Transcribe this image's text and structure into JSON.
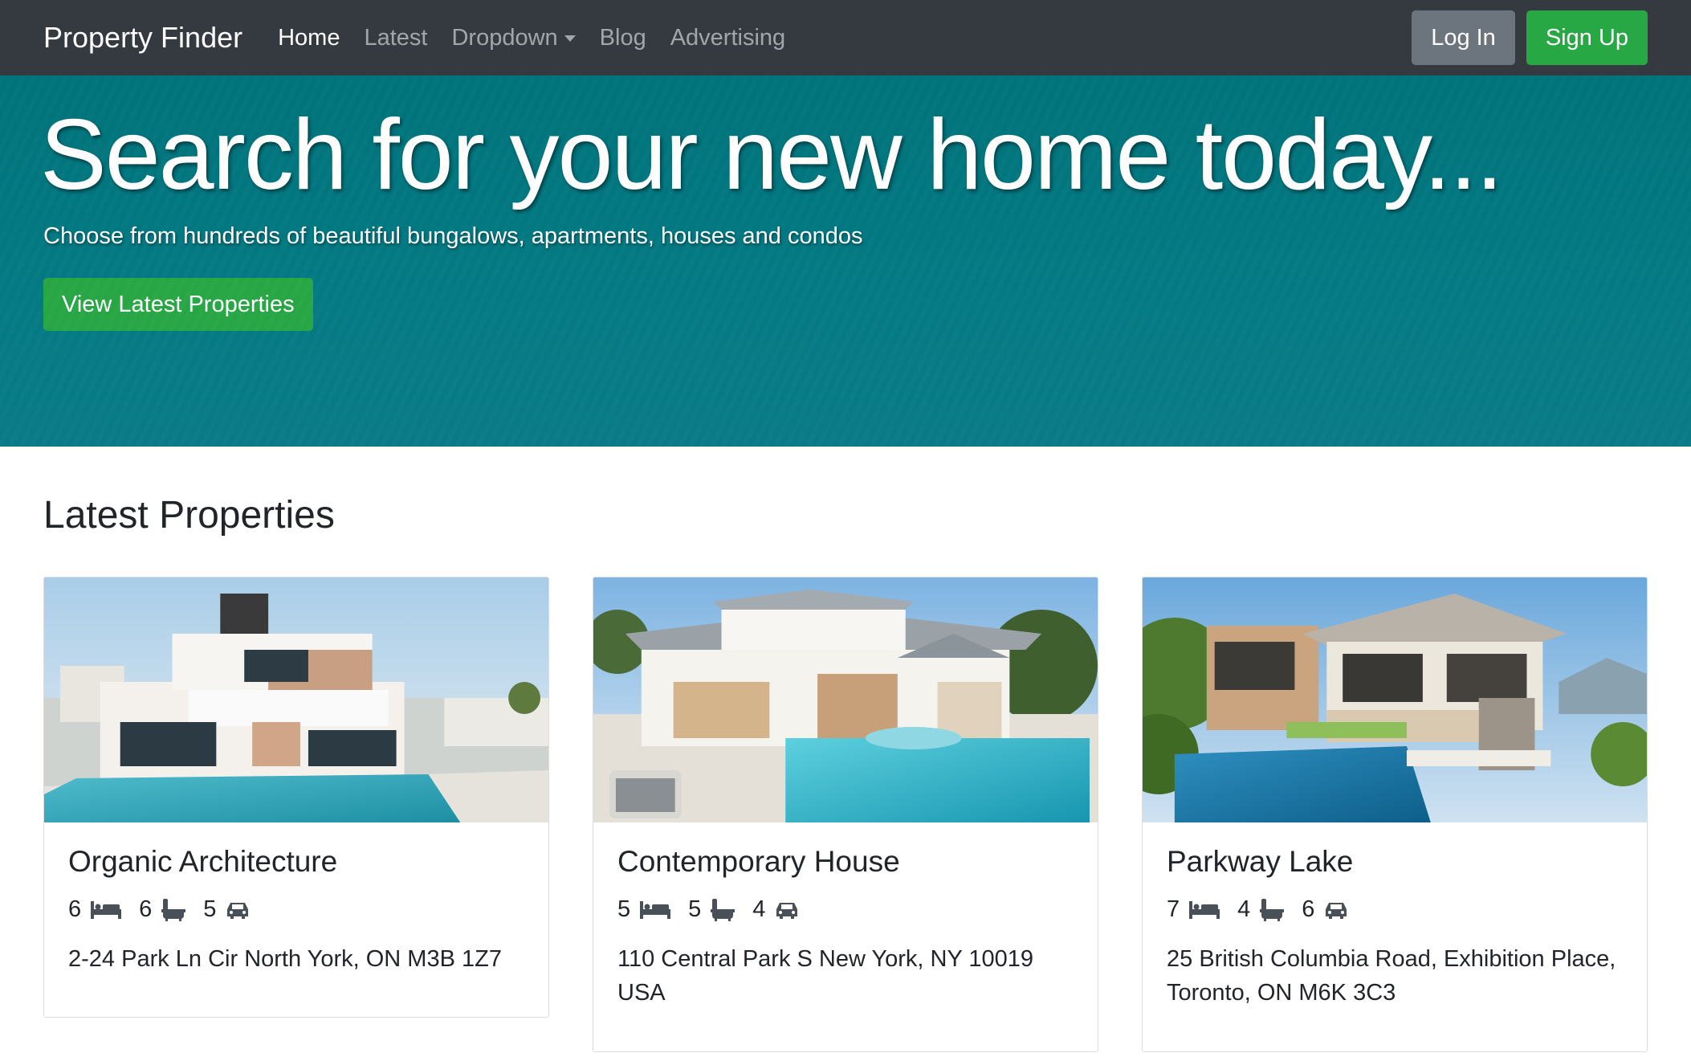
{
  "navbar": {
    "brand": "Property Finder",
    "links": [
      {
        "label": "Home"
      },
      {
        "label": "Latest"
      },
      {
        "label": "Dropdown"
      },
      {
        "label": "Blog"
      },
      {
        "label": "Advertising"
      }
    ],
    "login_label": "Log In",
    "signup_label": "Sign Up"
  },
  "hero": {
    "title": "Search for your new home today...",
    "subtitle": "Choose from hundreds of beautiful bungalows, apartments, houses and condos",
    "cta_label": "View Latest Properties"
  },
  "section": {
    "title": "Latest Properties"
  },
  "properties": [
    {
      "title": "Organic Architecture",
      "beds": "6",
      "baths": "6",
      "garages": "5",
      "address": "2-24 Park Ln Cir North York, ON M3B 1Z7"
    },
    {
      "title": "Contemporary House",
      "beds": "5",
      "baths": "5",
      "garages": "4",
      "address": "110 Central Park S New York, NY 10019 USA"
    },
    {
      "title": "Parkway Lake",
      "beds": "7",
      "baths": "4",
      "garages": "6",
      "address": "25 British Columbia Road, Exhibition Place, Toronto, ON M6K 3C3"
    }
  ],
  "colors": {
    "navbar_bg": "#343a40",
    "hero_bg": "#047a84",
    "success": "#28a745",
    "secondary": "#6c757d"
  },
  "icons": {
    "beds": "bed-icon",
    "baths": "bath-icon",
    "garages": "car-icon"
  }
}
